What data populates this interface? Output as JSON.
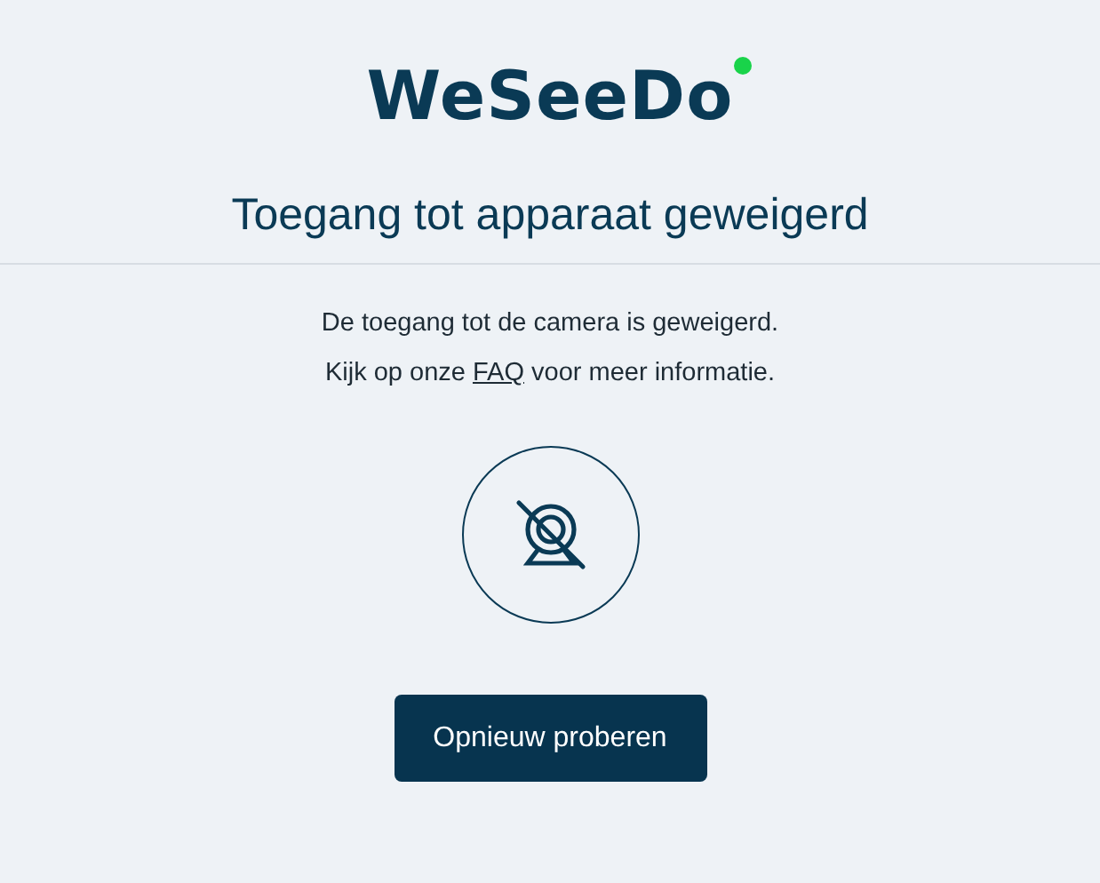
{
  "logo": {
    "text": "WeSeeDo"
  },
  "title": "Toegang tot apparaat geweigerd",
  "message": {
    "line_1": "De toegang tot de camera is geweigerd.",
    "line_2_before": "Kijk op onze ",
    "link": "FAQ",
    "line_2_after": " voor meer informatie."
  },
  "button": "Opnieuw proberen"
}
